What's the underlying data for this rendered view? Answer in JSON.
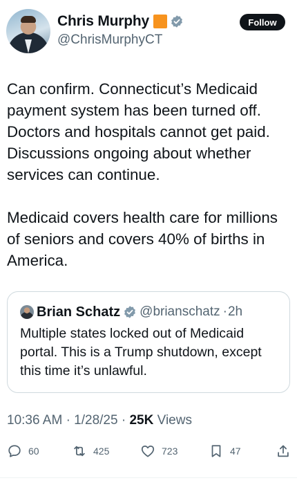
{
  "author": {
    "name": "Chris Murphy",
    "handle": "@ChrisMurphyCT",
    "follow_label": "Follow"
  },
  "tweet": {
    "text": "Can confirm. Connecticut’s Medicaid payment system has been turned off. Doctors and hospitals cannot get paid. Discussions ongoing about whether services can continue.\n\nMedicaid covers health care for millions of seniors and covers 40% of births in America."
  },
  "quote": {
    "name": "Brian Schatz",
    "handle": "@brianschatz",
    "separator": "·",
    "time": "2h",
    "text": "Multiple states locked out of Medicaid portal. This is a Trump shutdown, except this time it’s unlawful."
  },
  "meta": {
    "time": "10:36 AM",
    "separator": "·",
    "date": "1/28/25",
    "views_count": "25K",
    "views_label": "Views"
  },
  "actions": {
    "replies": "60",
    "reposts": "425",
    "likes": "723",
    "bookmarks": "47"
  },
  "colors": {
    "text": "#0f1419",
    "secondary": "#536471",
    "verified": "#829aab",
    "flag": "#f7931e",
    "border": "#cfd9de"
  }
}
